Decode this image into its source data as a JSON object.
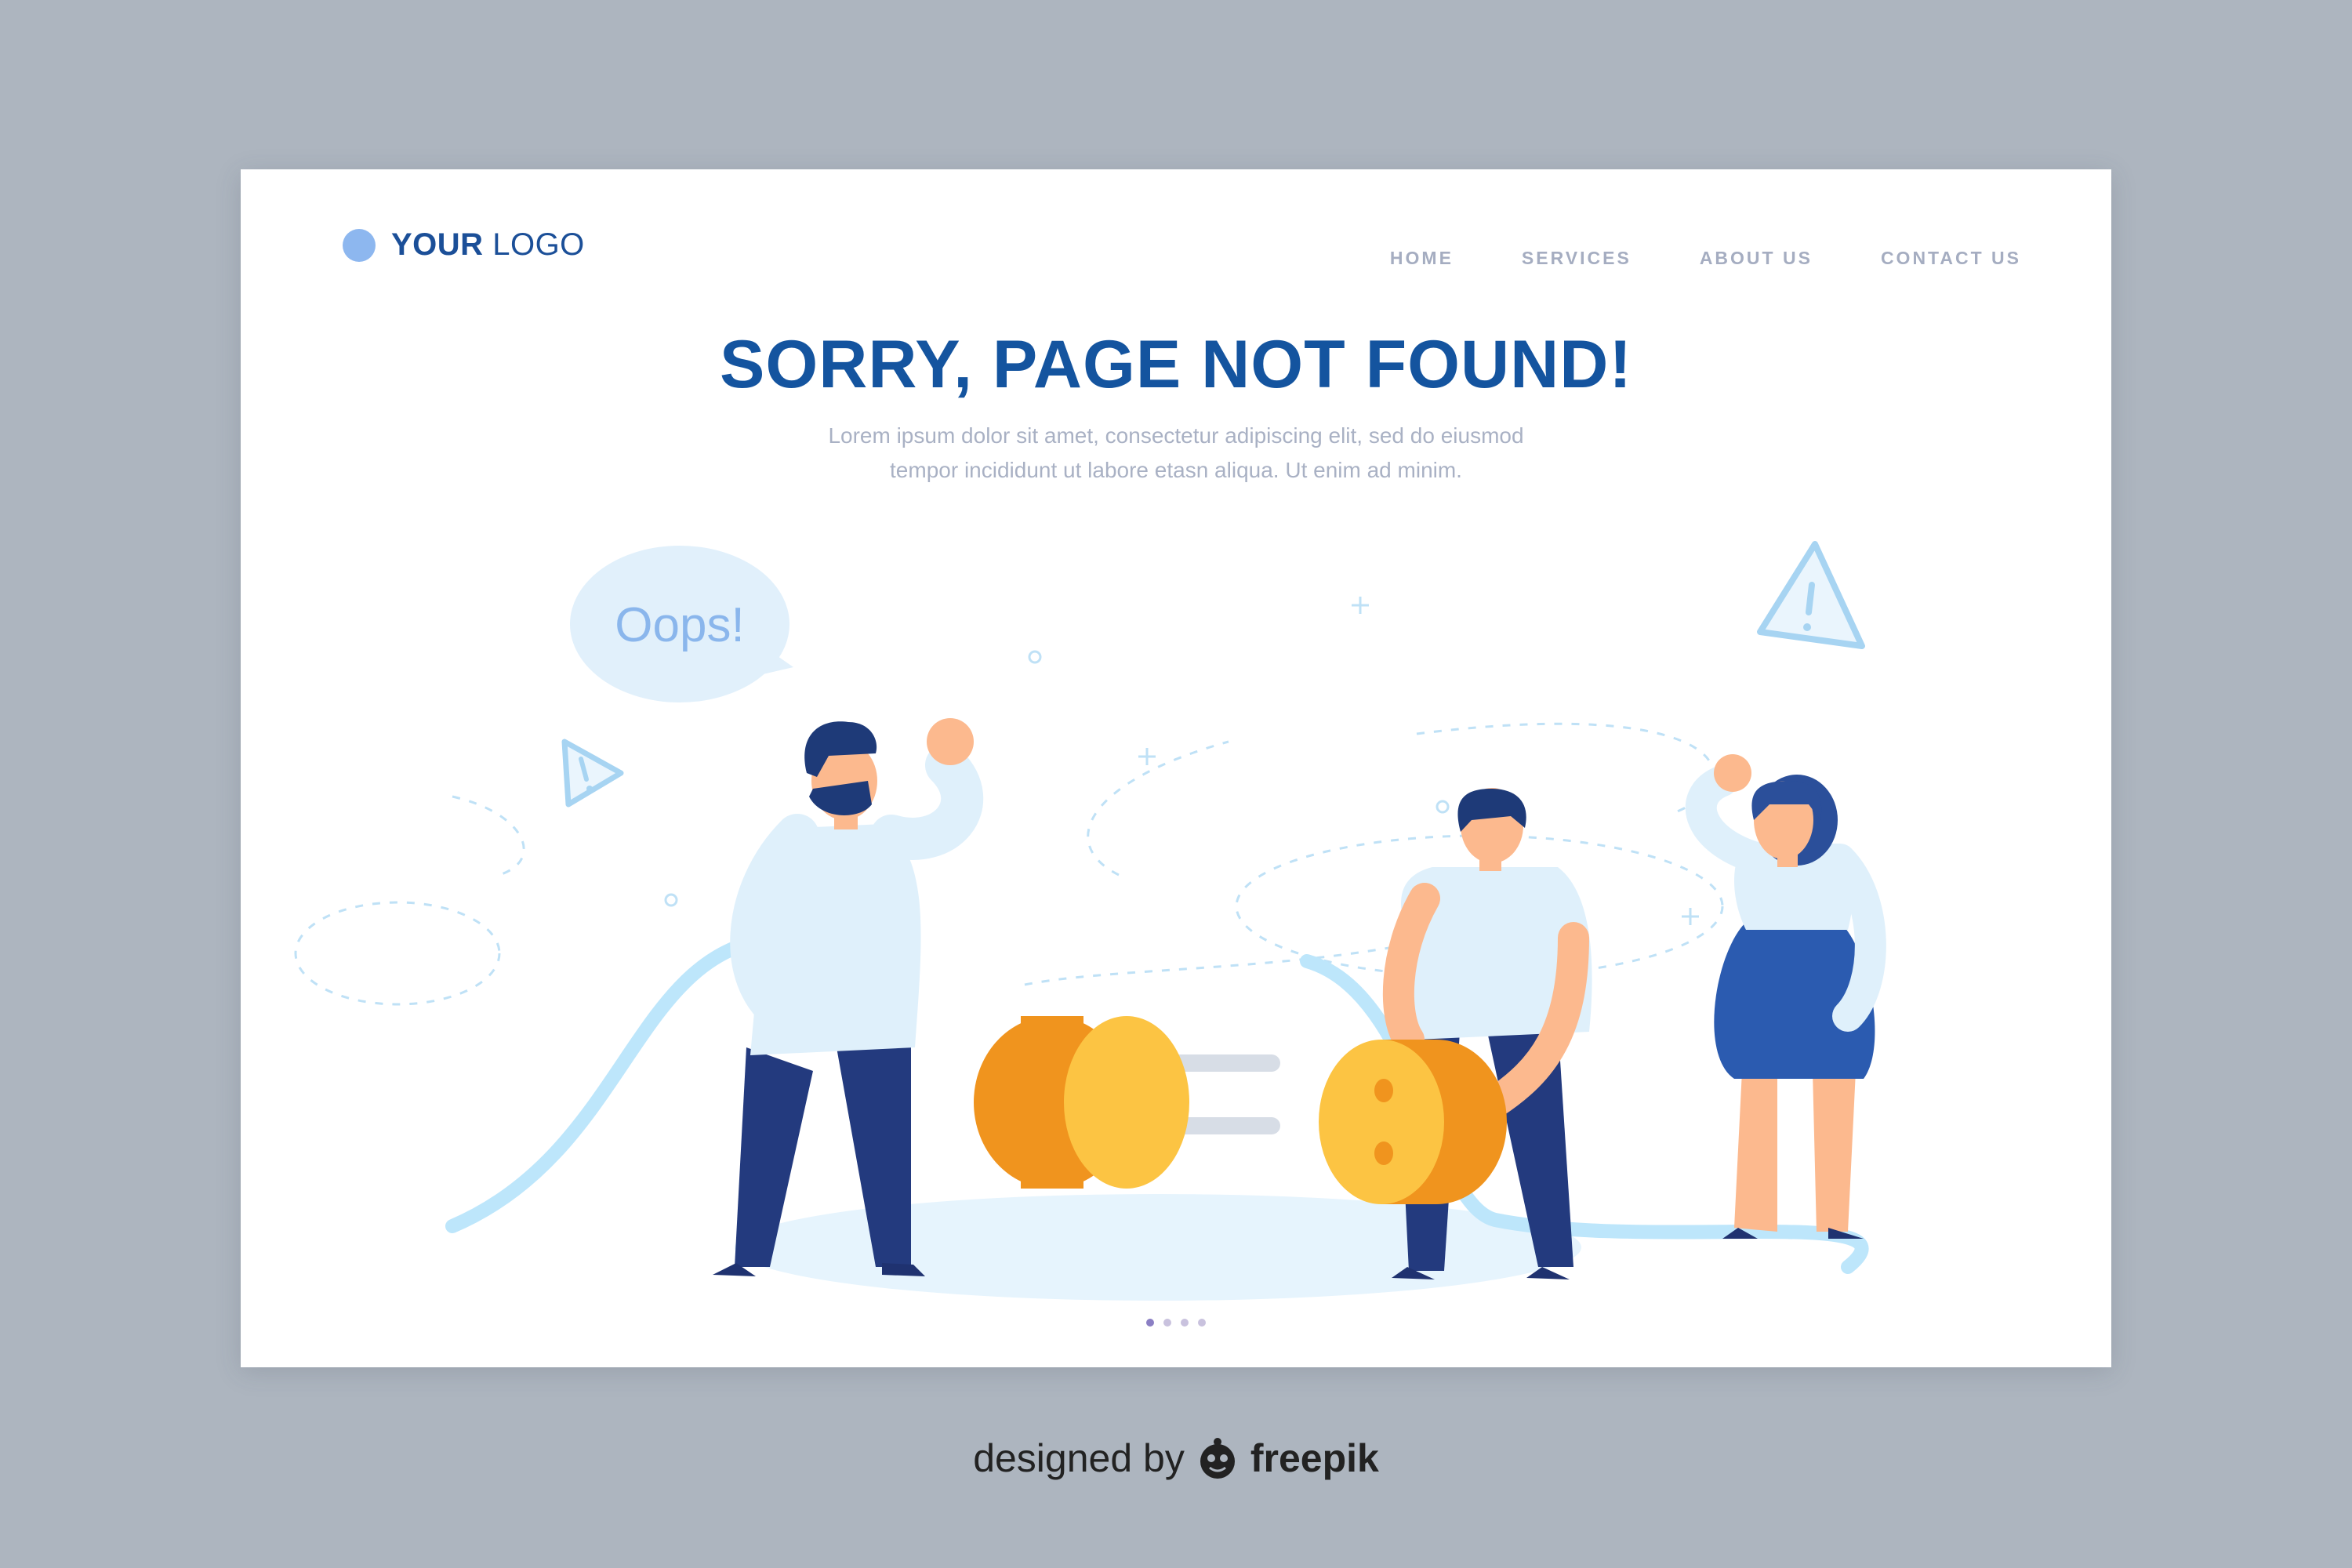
{
  "colors": {
    "background": "#adb5bf",
    "card": "#ffffff",
    "title": "#14549f",
    "nav_text": "#a5adc1",
    "logo_dot": "#8db7ef",
    "plug_orange": "#f0941e",
    "plug_yellow": "#fcc443",
    "shirt_light": "#dff0fb",
    "pants_navy": "#233a7e",
    "skirt_blue": "#2b5bb0",
    "cable": "#bde6fb"
  },
  "header": {
    "logo_bold": "YOUR",
    "logo_regular": "LOGO",
    "nav": [
      "HOME",
      "SERVICES",
      "ABOUT US",
      "CONTACT US"
    ]
  },
  "hero": {
    "title": "SORRY, PAGE NOT FOUND!",
    "subtitle_line1": "Lorem ipsum dolor sit amet, consectetur adipiscing elit, sed do eiusmod",
    "subtitle_line2": "tempor incididunt ut labore etasn aliqua. Ut enim ad minim."
  },
  "illustration": {
    "speech_bubble": "Oops!",
    "icons": [
      "warning-icon",
      "warning-icon",
      "plug-icon",
      "socket-icon"
    ]
  },
  "pagination": {
    "count": 4,
    "active_index": 0
  },
  "footer": {
    "designed_by": "designed by",
    "brand": "freepik"
  }
}
